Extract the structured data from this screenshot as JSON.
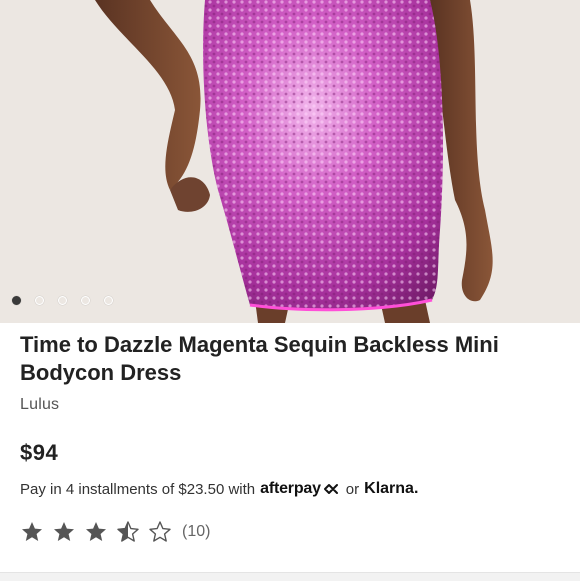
{
  "product": {
    "title": "Time to Dazzle Magenta Sequin Backless Mini Bodycon Dress",
    "brand": "Lulus",
    "price": "$94"
  },
  "gallery": {
    "image_count": 5,
    "active_index": 0
  },
  "installments": {
    "prefix": "Pay in 4 installments of $23.50 with",
    "afterpay_label": "afterpay",
    "connector": "or",
    "klarna_label": "Klarna."
  },
  "rating": {
    "value": 3.5,
    "max": 5,
    "count_label": "(10)"
  },
  "colors": {
    "dress": "#c54ab6",
    "skin": "#7a4a33",
    "background": "#ece7e2",
    "star": "#555555"
  }
}
